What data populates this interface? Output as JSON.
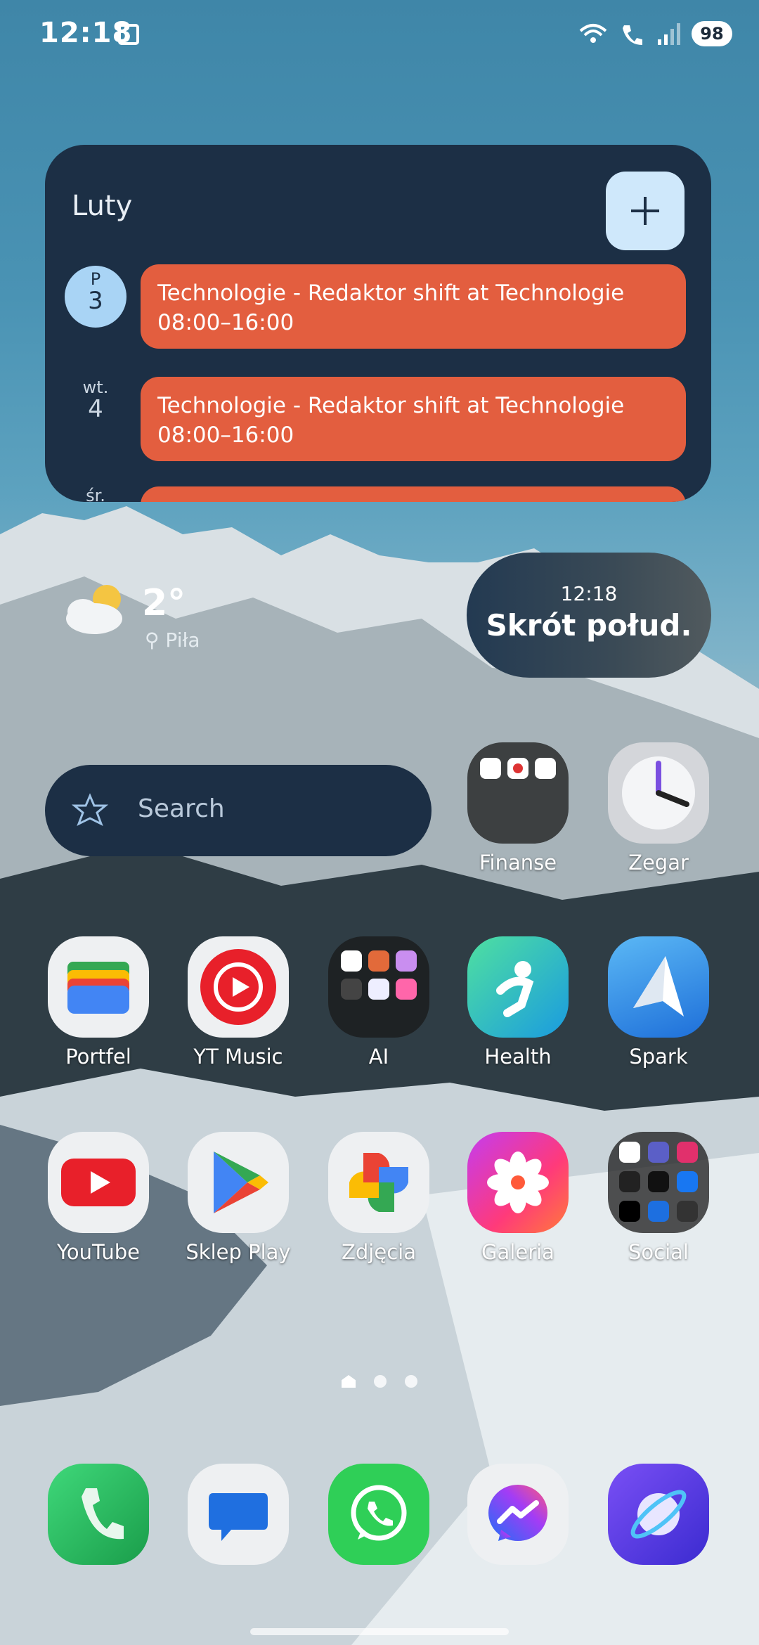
{
  "status": {
    "time": "12:18",
    "battery": "98"
  },
  "calendar": {
    "month": "Luty",
    "events": [
      {
        "day_name": "P",
        "day_num": "3",
        "title": "Technologie - Redaktor shift at Technologie",
        "hours": "08:00–16:00"
      },
      {
        "day_name": "wt.",
        "day_num": "4",
        "title": "Technologie - Redaktor shift at Technologie",
        "hours": "08:00–16:00"
      },
      {
        "day_name": "śr.",
        "day_num": "",
        "title": "",
        "hours": ""
      }
    ]
  },
  "weather": {
    "temp": "2°",
    "location": "Piła"
  },
  "clock_widget": {
    "time": "12:18",
    "label": "Skrót połud."
  },
  "search": {
    "placeholder": "Search"
  },
  "apps": {
    "finanse": "Finanse",
    "zegar": "Zegar",
    "portfel": "Portfel",
    "ytmusic": "YT Music",
    "ai": "AI",
    "health": "Health",
    "spark": "Spark",
    "youtube": "YouTube",
    "sklep": "Sklep Play",
    "zdjecia": "Zdjęcia",
    "galeria": "Galeria",
    "social": "Social"
  },
  "colors": {
    "widget_bg": "#1c2f45",
    "event": "#e35e3f",
    "today": "#a9d4f5"
  }
}
